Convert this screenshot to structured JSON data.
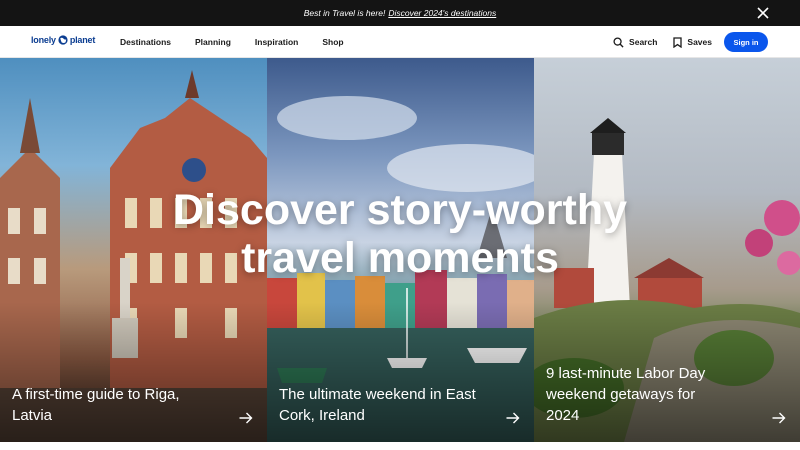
{
  "banner": {
    "lead": "Best in Travel is here!",
    "link": "Discover 2024's destinations",
    "close_icon": "close-icon"
  },
  "nav": {
    "logo_left": "lonely",
    "logo_right": "planet",
    "logo_icon": "globe-icon",
    "items": [
      "Destinations",
      "Planning",
      "Inspiration",
      "Shop"
    ],
    "search_label": "Search",
    "search_icon": "search-icon",
    "saves_label": "Saves",
    "saves_icon": "bookmark-icon",
    "signin_label": "Sign in",
    "signin_color": "#0a56ec"
  },
  "hero": {
    "headline_line1": "Discover story-worthy",
    "headline_line2": "travel moments",
    "panels": [
      {
        "caption": "A first-time guide to Riga, Latvia",
        "arrow_icon": "arrow-right-icon"
      },
      {
        "caption": "The ultimate weekend in East Cork, Ireland",
        "arrow_icon": "arrow-right-icon"
      },
      {
        "caption": "9 last-minute Labor Day weekend getaways for 2024",
        "arrow_icon": "arrow-right-icon"
      }
    ]
  }
}
